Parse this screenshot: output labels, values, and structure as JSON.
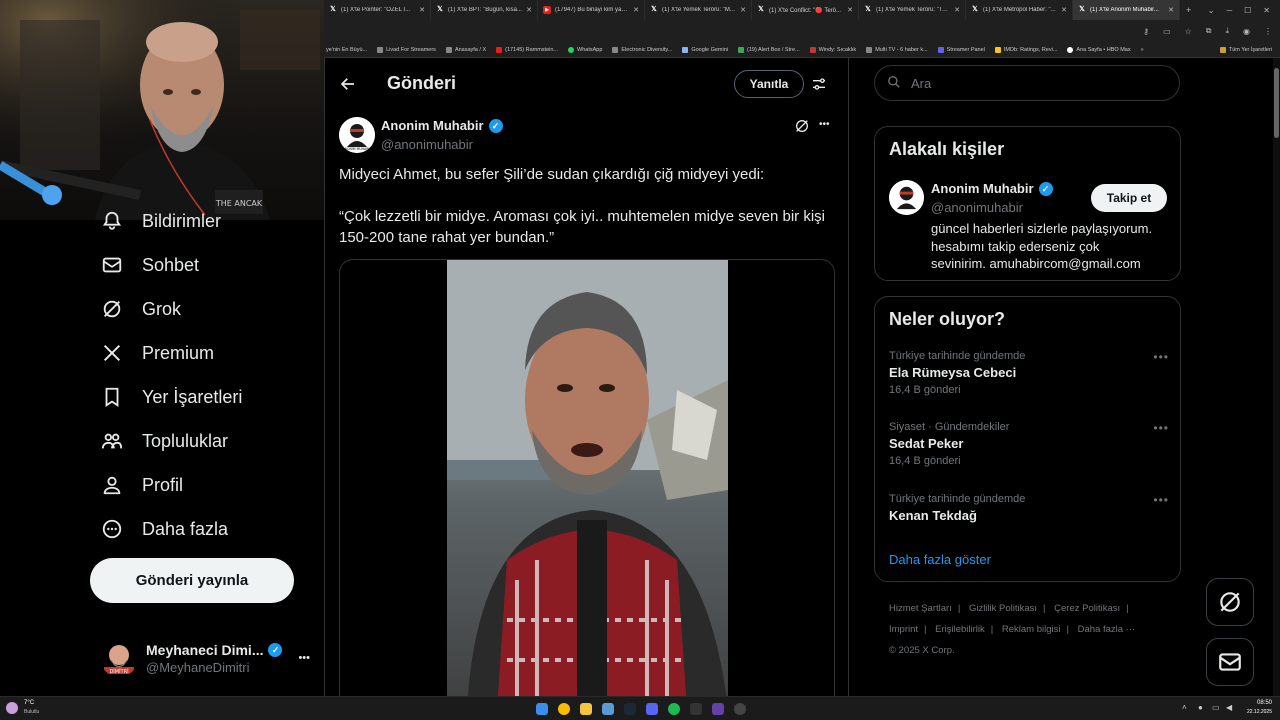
{
  "browser": {
    "tabs": [
      {
        "title": "(1) X'te Pointer: \"ÖZEL I..."
      },
      {
        "title": "(1) X'te BPT: \"Bugün, kısa..."
      },
      {
        "title": "(17947) Bu binayı kim yap..."
      },
      {
        "title": "(1) X'te Yemek Terörü: \"M..."
      },
      {
        "title": "(1) X'te Conflict: \"🔴 Terö..."
      },
      {
        "title": "(1) X'te Yemek Terörü: \"Ta..."
      },
      {
        "title": "(1) X'te Metropol Haber: \"..."
      },
      {
        "title": "(1) X'te Anonim Muhabir..."
      }
    ],
    "bookmarks": [
      "ye'nin En Büyü...",
      "Livad For Streamers",
      "Anasayfa / X",
      "(17145) Rammstein...",
      "WhatsApp",
      "Electronic Diversity...",
      "Google Gemini",
      "(19) Alert Box / Stre...",
      "Windy: Sıcaklık",
      "Multi TV - 6 haber k...",
      "Streamer Panel",
      "IMDb: Ratings, Revi...",
      "Ana Sayfa • HBO Max"
    ],
    "bookmarks_overflow": "»",
    "bookmarks_all": "Tüm Yer İşaretleri"
  },
  "leftnav": {
    "items": [
      {
        "label": "Bildirimler",
        "icon": "bell-icon"
      },
      {
        "label": "Sohbet",
        "icon": "mail-icon"
      },
      {
        "label": "Grok",
        "icon": "grok-icon"
      },
      {
        "label": "Premium",
        "icon": "x-logo-icon"
      },
      {
        "label": "Yer İşaretleri",
        "icon": "bookmark-icon"
      },
      {
        "label": "Topluluklar",
        "icon": "communities-icon"
      },
      {
        "label": "Profil",
        "icon": "profile-icon"
      },
      {
        "label": "Daha fazla",
        "icon": "more-circle-icon"
      }
    ],
    "post_button": "Gönderi yayınla",
    "account": {
      "name": "Meyhaneci Dimi...",
      "handle": "@MeyhaneDimitri",
      "avatar_text": "DİMİTRİ",
      "more": "•••"
    }
  },
  "main": {
    "title": "Gönderi",
    "reply_button": "Yanıtla",
    "tweet": {
      "author_name": "Anonim Muhabir",
      "author_handle": "@anonimuhabir",
      "avatar_text": "ANONİM MUHABİR",
      "more": "•••",
      "line1": "Midyeci Ahmet, bu sefer Şili’de sudan çıkardığı çiğ midyeyi yedi:",
      "line2": "“Çok lezzetli bir midye. Aroması çok iyi.. muhtemelen midye seven bir kişi",
      "line3": "150-200 tane rahat yer bundan.”"
    }
  },
  "right": {
    "search_placeholder": "Ara",
    "relevant": {
      "title": "Alakalı kişiler",
      "name": "Anonim Muhabir",
      "handle": "@anonimuhabir",
      "follow": "Takip et",
      "bio1": "güncel haberleri sizlerle paylaşıyorum.",
      "bio2": "hesabımı takip ederseniz çok",
      "bio3": "sevinirim. amuhabircom@gmail.com"
    },
    "trends": {
      "title": "Neler oluyor?",
      "items": [
        {
          "context": "Türkiye tarihinde gündemde",
          "name": "Ela Rümeysa Cebeci",
          "count": "16,4 B gönderi"
        },
        {
          "context": "Siyaset · Gündemdekiler",
          "name": "Sedat Peker",
          "count": "16,4 B gönderi"
        },
        {
          "context": "Türkiye tarihinde gündemde",
          "name": "Kenan Tekdağ",
          "count": ""
        }
      ],
      "more_dots": "•••",
      "show_more": "Daha fazla göster"
    },
    "footer": [
      "Hizmet Şartları",
      "|",
      "Gizlilik Politikası",
      "|",
      "Çerez Politikası",
      "|",
      "Imprint",
      "|",
      "Erişilebilirlik",
      "|",
      "Reklam bilgisi",
      "|",
      "Daha fazla ···",
      "© 2025 X Corp."
    ]
  },
  "taskbar": {
    "weather_temp": "7°C",
    "weather_desc": "Bulutlu",
    "time": "08:50",
    "date": "22.12.2025"
  },
  "colors": {
    "accent": "#1d9bf0",
    "background": "#000000",
    "border": "#2f3336",
    "muted": "#71767b"
  }
}
